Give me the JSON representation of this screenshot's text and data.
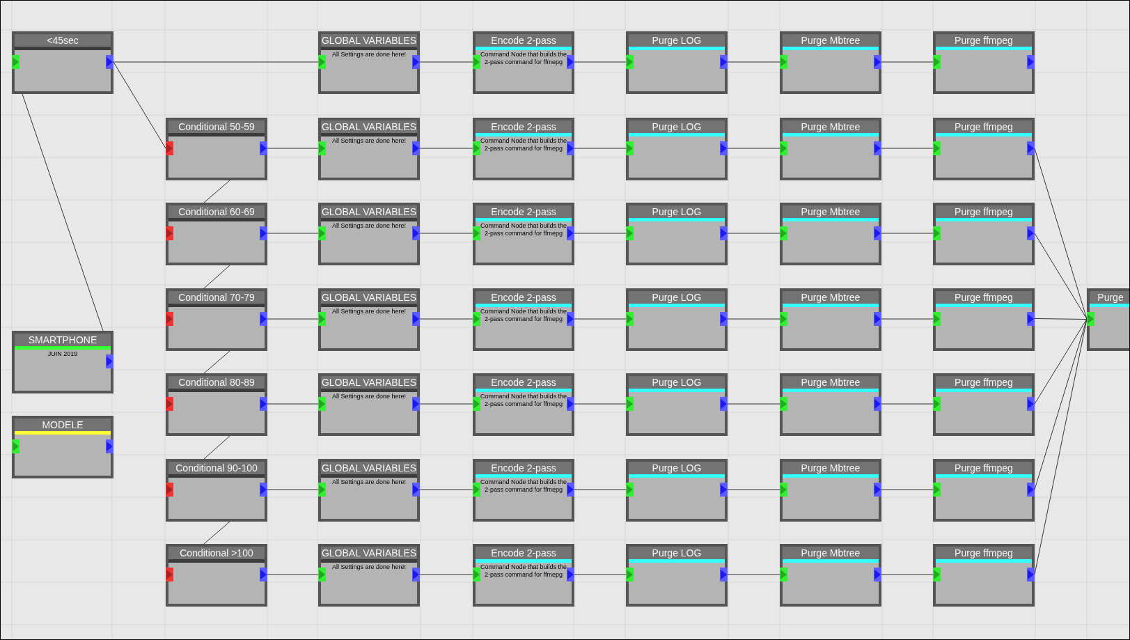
{
  "rows": [
    {
      "nodes": [
        {
          "title": "<45sec",
          "color": "#3c3c3c",
          "input": true,
          "condition": false,
          "output": true
        },
        {
          "title": "GLOBAL VARIABLES",
          "color": "#3c3c3c",
          "input": true,
          "condition": false,
          "output": true,
          "description": "All Settings are done here!"
        },
        {
          "title": "Encode 2-pass",
          "color": "#33ffff",
          "input": true,
          "condition": false,
          "output": true,
          "description": "Command Node that builds the 2-pass command for ffmepg"
        },
        {
          "title": "Purge LOG",
          "color": "#33ffff",
          "input": true,
          "condition": false,
          "output": true
        },
        {
          "title": "Purge Mbtree",
          "color": "#33ffff",
          "input": true,
          "condition": false,
          "output": true
        },
        {
          "title": "Purge ffmpeg",
          "color": "#33ffff",
          "input": true,
          "condition": false,
          "output": true
        }
      ]
    },
    {
      "to_sink": true,
      "nodes": [
        {
          "title": "Conditional 50-59",
          "color": "#3c3c3c",
          "input": true,
          "condition": true,
          "output": true
        },
        {
          "title": "GLOBAL VARIABLES",
          "color": "#3c3c3c",
          "input": true,
          "condition": false,
          "output": true,
          "description": "All Settings are done here!"
        },
        {
          "title": "Encode 2-pass",
          "color": "#33ffff",
          "input": true,
          "condition": false,
          "output": true,
          "description": "Command Node that builds the 2-pass command for ffmepg"
        },
        {
          "title": "Purge LOG",
          "color": "#33ffff",
          "input": true,
          "condition": false,
          "output": true
        },
        {
          "title": "Purge Mbtree",
          "color": "#33ffff",
          "input": true,
          "condition": false,
          "output": true
        },
        {
          "title": "Purge ffmpeg",
          "color": "#33ffff",
          "input": true,
          "condition": false,
          "output": true
        }
      ]
    },
    {
      "to_sink": true,
      "nodes": [
        {
          "title": "Conditional 60-69",
          "color": "#3c3c3c",
          "input": true,
          "condition": true,
          "output": true
        },
        {
          "title": "GLOBAL VARIABLES",
          "color": "#3c3c3c",
          "input": true,
          "condition": false,
          "output": true,
          "description": "All Settings are done here!"
        },
        {
          "title": "Encode 2-pass",
          "color": "#33ffff",
          "input": true,
          "condition": false,
          "output": true,
          "description": "Command Node that builds the 2-pass command for ffmepg"
        },
        {
          "title": "Purge LOG",
          "color": "#33ffff",
          "input": true,
          "condition": false,
          "output": true
        },
        {
          "title": "Purge Mbtree",
          "color": "#33ffff",
          "input": true,
          "condition": false,
          "output": true
        },
        {
          "title": "Purge ffmpeg",
          "color": "#33ffff",
          "input": true,
          "condition": false,
          "output": true
        }
      ]
    },
    {
      "to_sink": true,
      "nodes": [
        {
          "title": "Conditional 70-79",
          "color": "#3c3c3c",
          "input": true,
          "condition": true,
          "output": true
        },
        {
          "title": "GLOBAL VARIABLES",
          "color": "#3c3c3c",
          "input": true,
          "condition": false,
          "output": true,
          "description": "All Settings are done here!"
        },
        {
          "title": "Encode 2-pass",
          "color": "#33ffff",
          "input": true,
          "condition": false,
          "output": true,
          "description": "Command Node that builds the 2-pass command for ffmepg"
        },
        {
          "title": "Purge LOG",
          "color": "#33ffff",
          "input": true,
          "condition": false,
          "output": true
        },
        {
          "title": "Purge Mbtree",
          "color": "#33ffff",
          "input": true,
          "condition": false,
          "output": true
        },
        {
          "title": "Purge ffmpeg",
          "color": "#33ffff",
          "input": true,
          "condition": false,
          "output": true
        }
      ]
    },
    {
      "to_sink": true,
      "nodes": [
        {
          "title": "Conditional 80-89",
          "color": "#3c3c3c",
          "input": true,
          "condition": true,
          "output": true
        },
        {
          "title": "GLOBAL VARIABLES",
          "color": "#3c3c3c",
          "input": true,
          "condition": false,
          "output": true,
          "description": "All Settings are done here!"
        },
        {
          "title": "Encode 2-pass",
          "color": "#33ffff",
          "input": true,
          "condition": false,
          "output": true,
          "description": "Command Node that builds the 2-pass command for ffmepg"
        },
        {
          "title": "Purge LOG",
          "color": "#33ffff",
          "input": true,
          "condition": false,
          "output": true
        },
        {
          "title": "Purge Mbtree",
          "color": "#33ffff",
          "input": true,
          "condition": false,
          "output": true
        },
        {
          "title": "Purge ffmpeg",
          "color": "#33ffff",
          "input": true,
          "condition": false,
          "output": true
        }
      ]
    },
    {
      "to_sink": true,
      "nodes": [
        {
          "title": "Conditional 90-100",
          "color": "#3c3c3c",
          "input": true,
          "condition": true,
          "output": true
        },
        {
          "title": "GLOBAL VARIABLES",
          "color": "#3c3c3c",
          "input": true,
          "condition": false,
          "output": true,
          "description": "All Settings are done here!"
        },
        {
          "title": "Encode 2-pass",
          "color": "#33ffff",
          "input": true,
          "condition": false,
          "output": true,
          "description": "Command Node that builds the 2-pass command for ffmepg"
        },
        {
          "title": "Purge LOG",
          "color": "#33ffff",
          "input": true,
          "condition": false,
          "output": true
        },
        {
          "title": "Purge Mbtree",
          "color": "#33ffff",
          "input": true,
          "condition": false,
          "output": true
        },
        {
          "title": "Purge ffmpeg",
          "color": "#33ffff",
          "input": true,
          "condition": false,
          "output": true
        }
      ]
    },
    {
      "to_sink": true,
      "nodes": [
        {
          "title": "Conditional >100",
          "color": "#3c3c3c",
          "input": true,
          "condition": true,
          "output": true
        },
        {
          "title": "GLOBAL VARIABLES",
          "color": "#3c3c3c",
          "input": true,
          "condition": false,
          "output": true,
          "description": "All Settings are done here!"
        },
        {
          "title": "Encode 2-pass",
          "color": "#33ffff",
          "input": true,
          "condition": false,
          "output": true,
          "description": "Command Node that builds the 2-pass command for ffmepg"
        },
        {
          "title": "Purge LOG",
          "color": "#33ffff",
          "input": true,
          "condition": false,
          "output": true
        },
        {
          "title": "Purge Mbtree",
          "color": "#33ffff",
          "input": true,
          "condition": false,
          "output": true
        },
        {
          "title": "Purge ffmpeg",
          "color": "#33ffff",
          "input": true,
          "condition": false,
          "output": true
        }
      ]
    }
  ],
  "side_nodes": [
    {
      "title": "SMARTPHONE",
      "color": "#33ff33",
      "output": true,
      "description": "JUIN 2019"
    },
    {
      "title": "MODELE",
      "color": "#ffff33",
      "input": true,
      "condition": false,
      "output": true
    }
  ],
  "sink": {
    "title": "Purge",
    "color": "#33ffff",
    "input": true,
    "condition": false
  }
}
